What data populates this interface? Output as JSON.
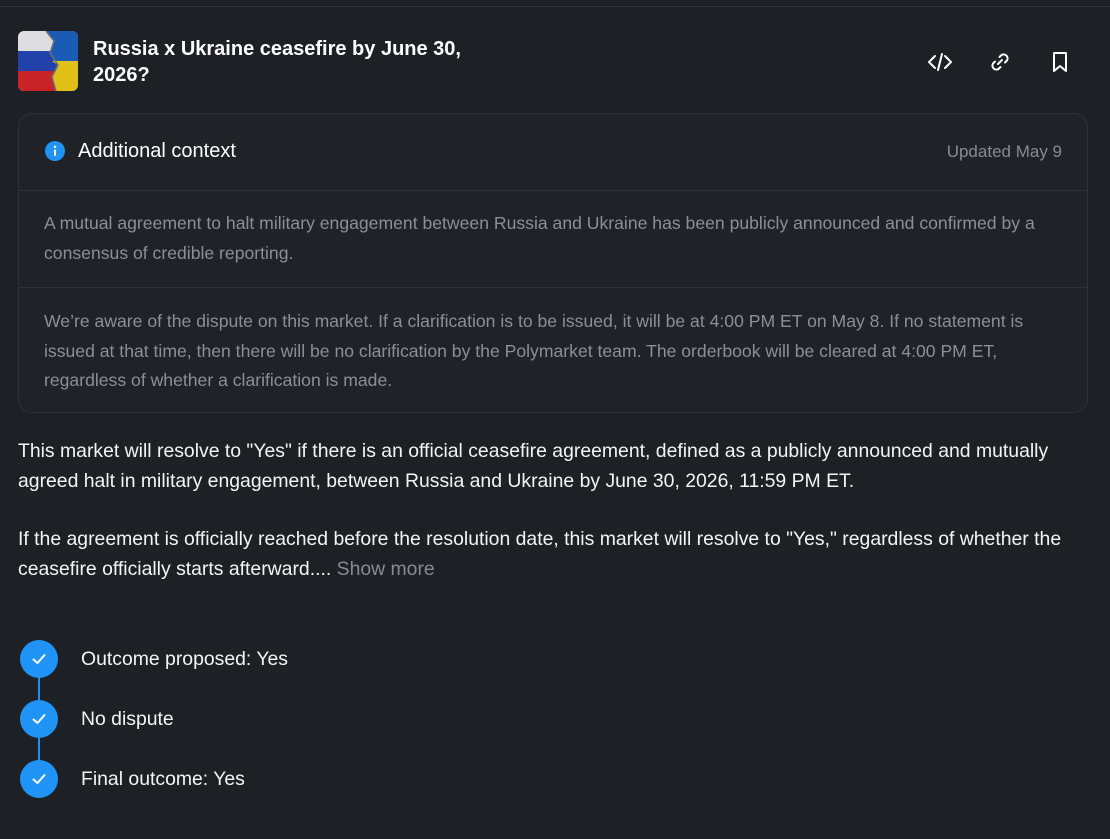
{
  "market": {
    "title": "Russia x Ukraine ceasefire by June 30, 2026?",
    "image_icon": "russia-ukraine-flag"
  },
  "header_actions": [
    {
      "icon": "code-embed-icon"
    },
    {
      "icon": "link-icon"
    },
    {
      "icon": "bookmark-icon"
    }
  ],
  "context": {
    "icon": "info-icon",
    "title": "Additional context",
    "updated": "Updated May 9",
    "paragraphs": [
      "A mutual agreement to halt military engagement between Russia and Ukraine has been publicly announced and confirmed by a consensus of credible reporting.",
      "We’re aware of the dispute on this market. If a clarification is to be issued, it will be at 4:00 PM ET on May 8. If no statement is issued at that time, then there will be no clarification by the Polymarket team. The orderbook will be cleared at 4:00 PM ET, regardless of whether a clarification is made."
    ]
  },
  "description": {
    "paragraph1": "This market will resolve to \"Yes\" if there is an official ceasefire agreement, defined as a publicly announced and mutually agreed halt in military engagement, between Russia and Ukraine by June 30, 2026, 11:59 PM ET.",
    "paragraph2": "If the agreement is officially reached before the resolution date, this market will resolve to \"Yes,\" regardless of whether the ceasefire officially starts afterward....",
    "show_more": "Show more"
  },
  "timeline": [
    {
      "label": "Outcome proposed: Yes",
      "status": "complete"
    },
    {
      "label": "No dispute",
      "status": "complete"
    },
    {
      "label": "Final outcome: Yes",
      "status": "complete"
    }
  ],
  "colors": {
    "background": "#1d2025",
    "accent": "#1f93f6",
    "muted_text": "#8a9099",
    "border": "#2d3138"
  }
}
